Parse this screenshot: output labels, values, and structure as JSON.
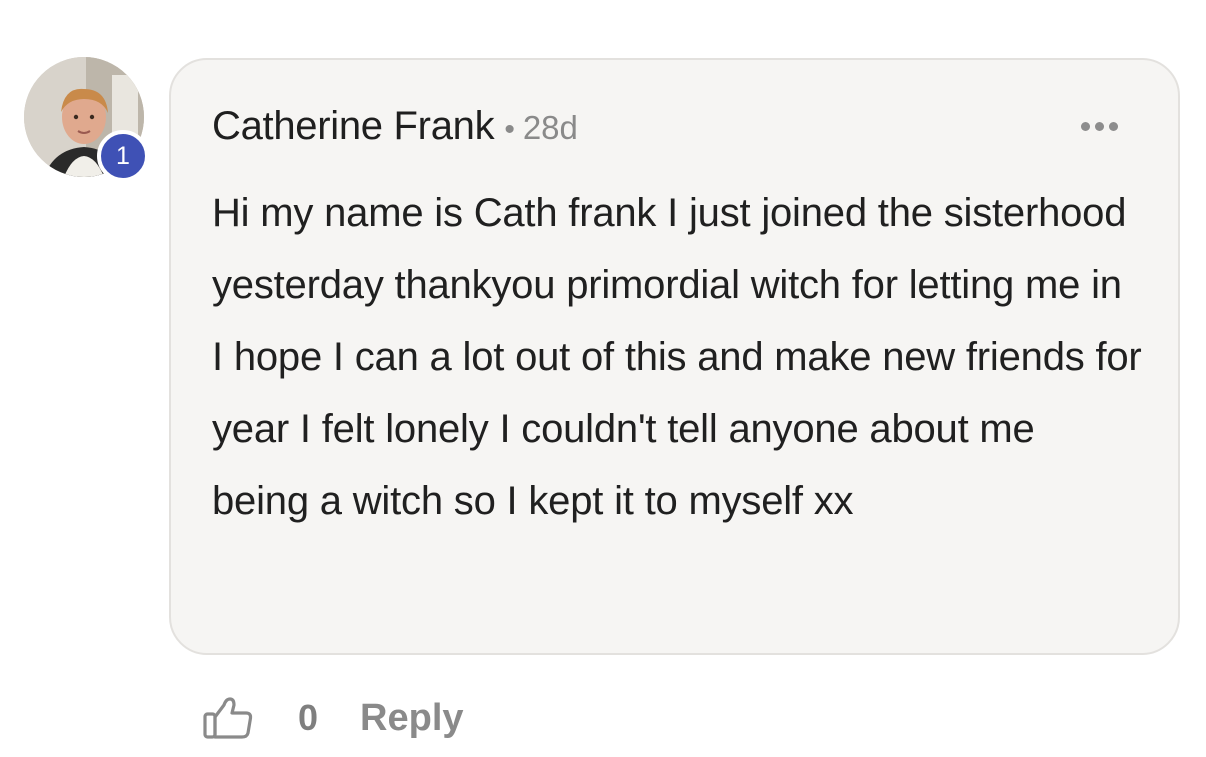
{
  "comment": {
    "author": "Catherine Frank",
    "separator": "•",
    "timestamp": "28d",
    "level_badge": "1",
    "text": "Hi my name is Cath frank I just joined the sisterhood yesterday thankyou primordial witch for letting me in I hope I can a lot out of this and make new friends for year I felt lonely I couldn't tell anyone about me being a witch so I kept it to myself xx",
    "more_icon": "more-horizontal-icon"
  },
  "actions": {
    "like_icon": "thumbs-up-icon",
    "like_count": "0",
    "reply_label": "Reply"
  },
  "colors": {
    "badge": "#3f51b5",
    "bubble_bg": "#f6f5f3",
    "bubble_border": "#e3e1de",
    "muted_text": "#8a8a8a"
  }
}
